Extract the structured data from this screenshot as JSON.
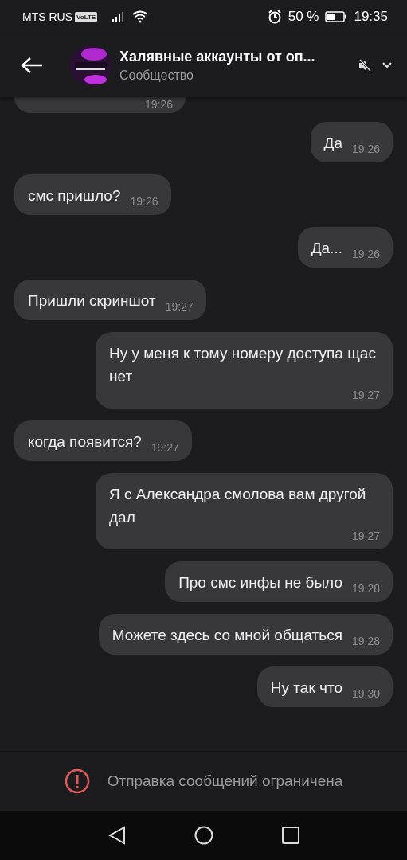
{
  "status_bar": {
    "carrier": "MTS RUS",
    "volte": "VoLTE",
    "battery_text": "50 %",
    "time": "19:35"
  },
  "header": {
    "title": "Халявные аккаунты от оп...",
    "subtitle": "Сообщество",
    "muted": true
  },
  "messages": [
    {
      "kind": "partial",
      "time": "19:26"
    },
    {
      "kind": "outgoing",
      "text": "Да",
      "time": "19:26"
    },
    {
      "kind": "incoming",
      "text": "смс пришло?",
      "time": "19:26"
    },
    {
      "kind": "outgoing",
      "text": "Да...",
      "time": "19:26"
    },
    {
      "kind": "incoming",
      "text": "Пришли скриншот",
      "time": "19:27"
    },
    {
      "kind": "outgoing",
      "text": "Ну у меня к тому номеру доступа щас нет",
      "time": "19:27"
    },
    {
      "kind": "incoming",
      "text": "когда появится?",
      "time": "19:27"
    },
    {
      "kind": "outgoing",
      "text": "Я с Александра смолова вам другой дал",
      "time": "19:27"
    },
    {
      "kind": "outgoing",
      "text": "Про смс инфы не было",
      "time": "19:28"
    },
    {
      "kind": "outgoing",
      "text": "Можете здесь со мной общаться",
      "time": "19:28"
    },
    {
      "kind": "outgoing",
      "text": "Ну так что",
      "time": "19:30"
    }
  ],
  "notice": "Отправка сообщений ограничена"
}
